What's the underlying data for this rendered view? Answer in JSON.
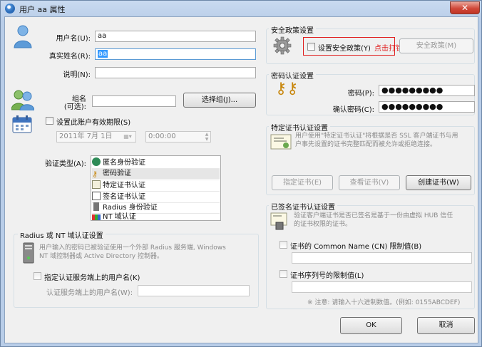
{
  "window": {
    "title": "用户 aa 属性",
    "close_glyph": "✕"
  },
  "user": {
    "username_label": "用户名(U):",
    "username_value": "aa",
    "realname_label": "真实姓名(R):",
    "realname_value": "aa",
    "desc_label": "说明(N):",
    "desc_value": "",
    "group_label_1": "组名",
    "group_label_2": "(可选):",
    "group_value": "",
    "select_group_button": "选择组(J)...",
    "expiry_checkbox_label": "设置此账户有效期限(S)",
    "expiry_date": "2011年  7月  1日",
    "expiry_time": "0:00:00"
  },
  "auth": {
    "type_label": "验证类型(A):",
    "items": [
      {
        "label": "匿名身份验证",
        "icon": "anonymous-icon"
      },
      {
        "label": "密码验证",
        "icon": "key-icon",
        "selected": true
      },
      {
        "label": "特定证书认证",
        "icon": "certificate-icon"
      },
      {
        "label": "签名证书认证",
        "icon": "signed-certificate-icon"
      },
      {
        "label": "Radius 身份验证",
        "icon": "radius-server-icon"
      },
      {
        "label": "NT 域认证",
        "icon": "nt-domain-icon"
      }
    ]
  },
  "radius": {
    "group_title": "Radius 或 NT 域认证设置",
    "desc_line1": "用户输入的密码已被验证使用一个外部 Radius 服务端, Windows",
    "desc_line2": "NT 域控制器或 Active Directory 控制器。",
    "checkbox_label": "指定认证服务端上的用户名(K)",
    "server_username_label": "认证服务端上的用户名(W):",
    "server_username_value": ""
  },
  "security_policy": {
    "group_title": "安全政策设置",
    "checkbox_label": "设置安全政策(Y)",
    "annotation": "点击打钩",
    "button": "安全政策(M)"
  },
  "password": {
    "group_title": "密码认证设置",
    "password_label": "密码(P):",
    "password_value": "●●●●●●●●●",
    "confirm_label": "确认密码(C):",
    "confirm_value": "●●●●●●●●●"
  },
  "specific_cert": {
    "group_title": "特定证书认证设置",
    "desc_line1": "用户使用\"特定证书认证\"将根据是否 SSL 客户端证书与用",
    "desc_line2": "户事先设置的证书完整匹配而被允许或拒绝连接。",
    "btn_specify": "指定证书(E)",
    "btn_view": "查看证书(V)",
    "btn_create": "创建证书(W)"
  },
  "signed_cert": {
    "group_title": "已签名证书认证设置",
    "desc_line1": "验证客户端证书是否已签名是基于一份由虚拟 HUB 信任",
    "desc_line2": "的证书权限的证书。",
    "cn_checkbox_label": "证书的 Common Name (CN) 限制值(B)",
    "cn_value": "",
    "serial_checkbox_label": "证书序列号的限制值(L)",
    "serial_value": "",
    "note": "※ 注意: 请输入十六进制数值。(例如: 0155ABCDEF)"
  },
  "footer": {
    "ok": "OK",
    "cancel": "取消"
  },
  "colors": {
    "annotation_red": "#e02020",
    "selection_blue": "#3399ff"
  }
}
